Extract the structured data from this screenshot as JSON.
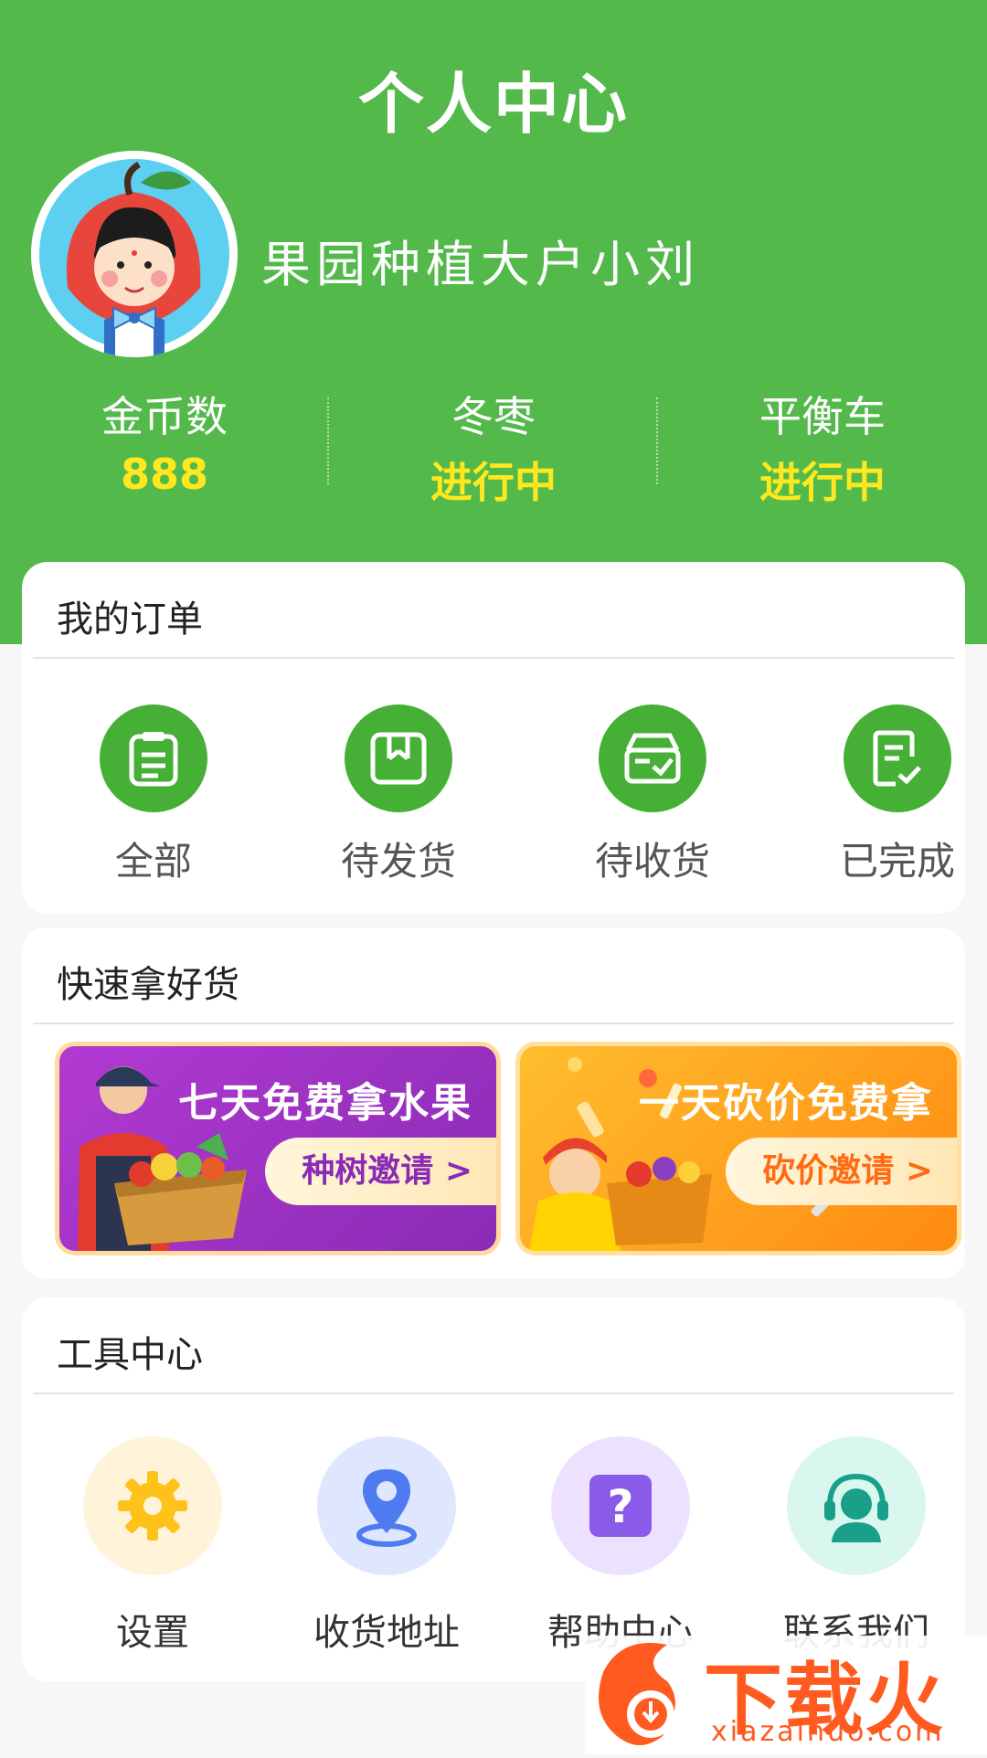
{
  "header": {
    "title": "个人中心",
    "username": "果园种植大户小刘",
    "avatar_icon": "apple-boy-avatar-icon",
    "stats": [
      {
        "label": "金币数",
        "value": "888"
      },
      {
        "label": "冬枣",
        "value": "进行中"
      },
      {
        "label": "平衡车",
        "value": "进行中"
      }
    ]
  },
  "orders": {
    "title": "我的订单",
    "items": [
      {
        "label": "全部",
        "icon": "clipboard-icon"
      },
      {
        "label": "待发货",
        "icon": "package-icon"
      },
      {
        "label": "待收货",
        "icon": "inbox-check-icon"
      },
      {
        "label": "已完成",
        "icon": "document-check-icon"
      }
    ]
  },
  "promo": {
    "title": "快速拿好货",
    "banners": [
      {
        "title": "七天免费拿水果",
        "button": "种树邀请 >"
      },
      {
        "title": "一天砍价免费拿",
        "button": "砍价邀请 >"
      }
    ]
  },
  "tools": {
    "title": "工具中心",
    "items": [
      {
        "label": "设置",
        "icon": "gear-icon"
      },
      {
        "label": "收货地址",
        "icon": "location-pin-icon"
      },
      {
        "label": "帮助中心",
        "icon": "question-icon"
      },
      {
        "label": "联系我们",
        "icon": "headset-agent-icon"
      }
    ]
  },
  "watermark": {
    "text": "下载火",
    "url": "xiazaihuo.com"
  },
  "colors": {
    "brand_green": "#52b94a",
    "highlight_yellow": "#ffe81f",
    "banner_purple": "#9b2fc0",
    "banner_orange": "#ff9a1c"
  }
}
